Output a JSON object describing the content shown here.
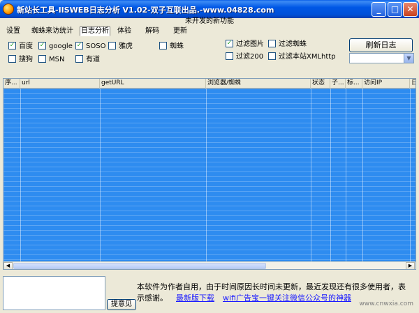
{
  "window": {
    "title": "新站长工具-IISWEB日志分析 V1.02-双子互联出品.-www.04828.com",
    "banner": "未开发的新功能",
    "min_glyph": "_",
    "max_glyph": "□",
    "close_glyph": "✕"
  },
  "tabs": [
    "设置",
    "蜘蛛来访统计",
    "日志分析",
    "体验",
    "解码",
    "更新"
  ],
  "filters": {
    "engines": [
      {
        "label": "百度",
        "checked": true
      },
      {
        "label": "google",
        "checked": true
      },
      {
        "label": "SOSO",
        "checked": true
      },
      {
        "label": "雅虎",
        "checked": false
      },
      {
        "label": "蜘蛛",
        "checked": false
      },
      {
        "label": "搜狗",
        "checked": false
      },
      {
        "label": "MSN",
        "checked": false
      },
      {
        "label": "有道",
        "checked": false
      }
    ],
    "options": [
      {
        "label": "过滤图片",
        "checked": true
      },
      {
        "label": "过滤蜘蛛",
        "checked": false
      },
      {
        "label": "过滤200",
        "checked": false
      },
      {
        "label": "过滤本站XMLhttp",
        "checked": false
      }
    ],
    "check_glyph": "✓"
  },
  "refresh_button": "刷新日志",
  "combo_arrow": "▼",
  "grid": {
    "columns": [
      "序...",
      "url",
      "getURL",
      "浏览器/蜘蛛",
      "状态",
      "子...",
      "标...",
      "访问IP",
      "日"
    ],
    "scroll_left": "◀",
    "scroll_right": "▶"
  },
  "bottom": {
    "feedback_button": "提意见",
    "notice_line1": "本软件为作者自用，由于时间原因长时间未更新，最近发现还有很多使用者，表",
    "notice_line2": "示感谢。",
    "link_download": "最新版下载",
    "link_wifi": "wifi广告宝一键关注微信公众号的神器",
    "watermark": "www.cnwxia.com"
  }
}
